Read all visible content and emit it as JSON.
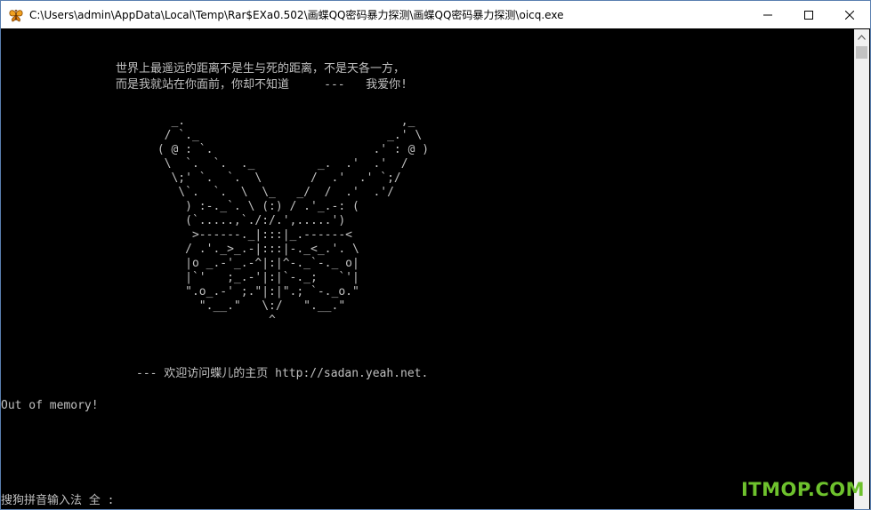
{
  "window": {
    "title": "C:\\Users\\admin\\AppData\\Local\\Temp\\Rar$EXa0.502\\画蝶QQ密码暴力探测\\画蝶QQ密码暴力探测\\oicq.exe"
  },
  "console": {
    "poem_line1": "世界上最遥远的距离不是生与死的距离，不是天各一方，",
    "poem_line2": "而是我就站在你面前，你却不知道     ---   我爱你!",
    "butterfly_art": "   _.                               ,_\n  / `._                           _.' \\\n ( @ : `.                       .' : @ )\n  \\  `.  `.  ._         _.  .'  .'  /\n   \\;' `.  `.  \\       /  .'  .' `;/\n    \\`.  `.  \\  \\_   _/  /  .'  .'/\n     ) :-._`. \\ (:) / .'_.-: (\n     (`.....,`./:/.',.....')\n      >------._|:::|_.------<\n     / .'._>_.-|:::|-._<_.'. \\\n     |o _.-'_.-^|:|^-._`-._ o|\n     |`'   ;_.-'|:|`-._;   `'|\n     \".o_.-' ;.\"|:|\".; `-._o.\"\n       \".__.\"   \\:/   \".__.\"\n                 ^",
    "homepage_line": "--- 欢迎访问蝶儿的主页 http://sadan.yeah.net.",
    "error_line": "Out of memory!",
    "ime_status": "搜狗拼音输入法 全 :"
  },
  "watermark": "ITMOP.COM",
  "colors": {
    "console_bg": "#000000",
    "console_text": "#c0c0c0",
    "watermark": "#6ec22d"
  },
  "icons": {
    "app": "butterfly-icon",
    "minimize": "minimize-icon",
    "maximize": "maximize-icon",
    "close": "close-icon",
    "scroll_up": "chevron-up-icon"
  }
}
